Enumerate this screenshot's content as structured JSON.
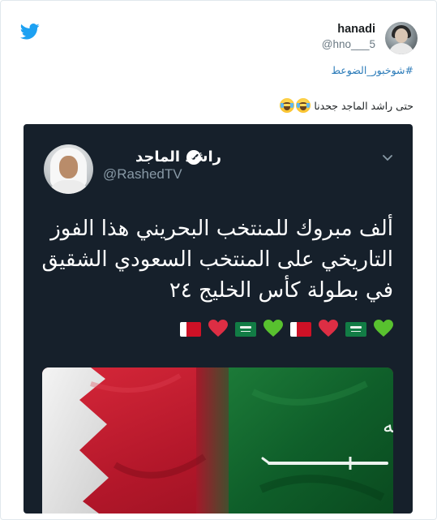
{
  "tweet": {
    "author_name": "hanadi",
    "author_handle": "@hno___5",
    "hashtag": "#شوخبور_الضوعط",
    "text": "حتى راشد الماجد جحدنا",
    "colors": {
      "link": "#2b7bb9",
      "bird": "#1da1f2",
      "text": "#1c2022",
      "muted": "#697882"
    }
  },
  "embedded": {
    "author_name": "راشد الماجد",
    "author_handle": "@RashedTV",
    "text": "ألف مبروك للمنتخب البحريني هذا الفوز التاريخي على المنتخب السعودي الشقيق في بطولة كأس الخليج ٢٤",
    "emoji_row": [
      "green-heart",
      "saudi-flag",
      "red-heart",
      "bahrain-flag",
      "green-heart",
      "saudi-flag",
      "red-heart",
      "bahrain-flag"
    ],
    "photo_alt": "Bahrain and Saudi Arabia flags",
    "flag_text": "لا إله إلا الله محمد رسول الله",
    "colors": {
      "background": "#16202b",
      "text": "#ffffff",
      "muted": "#8899a6",
      "verified": "#ffffff"
    }
  }
}
